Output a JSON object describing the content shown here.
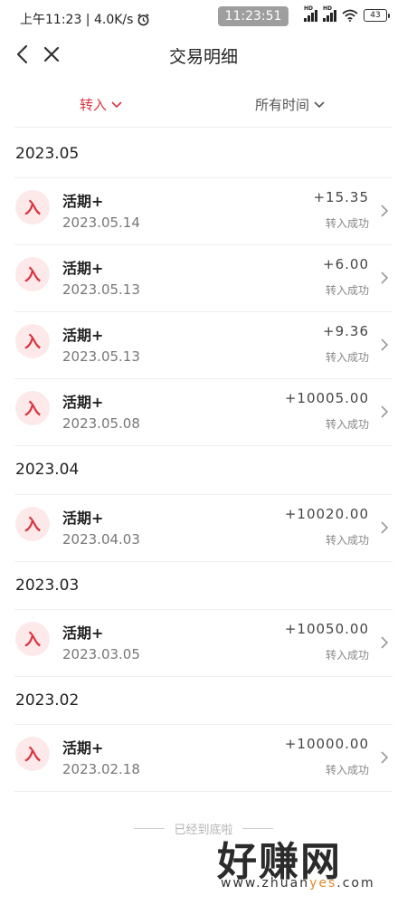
{
  "status_bar": {
    "left_text": "上午11:23 | 4.0K/s",
    "clock": "11:23:51",
    "battery": "43"
  },
  "header": {
    "title": "交易明细"
  },
  "filters": {
    "type_label": "转入",
    "time_label": "所有时间"
  },
  "groups": [
    {
      "month": "2023.05",
      "items": [
        {
          "icon": "入",
          "name": "活期+",
          "date": "2023.05.14",
          "amount": "+15.35",
          "status": "转入成功"
        },
        {
          "icon": "入",
          "name": "活期+",
          "date": "2023.05.13",
          "amount": "+6.00",
          "status": "转入成功"
        },
        {
          "icon": "入",
          "name": "活期+",
          "date": "2023.05.13",
          "amount": "+9.36",
          "status": "转入成功"
        },
        {
          "icon": "入",
          "name": "活期+",
          "date": "2023.05.08",
          "amount": "+10005.00",
          "status": "转入成功"
        }
      ]
    },
    {
      "month": "2023.04",
      "items": [
        {
          "icon": "入",
          "name": "活期+",
          "date": "2023.04.03",
          "amount": "+10020.00",
          "status": "转入成功"
        }
      ]
    },
    {
      "month": "2023.03",
      "items": [
        {
          "icon": "入",
          "name": "活期+",
          "date": "2023.03.05",
          "amount": "+10050.00",
          "status": "转入成功"
        }
      ]
    },
    {
      "month": "2023.02",
      "items": [
        {
          "icon": "入",
          "name": "活期+",
          "date": "2023.02.18",
          "amount": "+10000.00",
          "status": "转入成功"
        }
      ]
    }
  ],
  "footer": {
    "end_text": "已经到底啦"
  },
  "watermark": {
    "text": "好赚网",
    "url_prefix": "www.zhuan",
    "url_highlight": "yes",
    "url_suffix": ".com"
  },
  "colors": {
    "accent": "#d9333f",
    "icon_bg": "#fde9e9"
  }
}
